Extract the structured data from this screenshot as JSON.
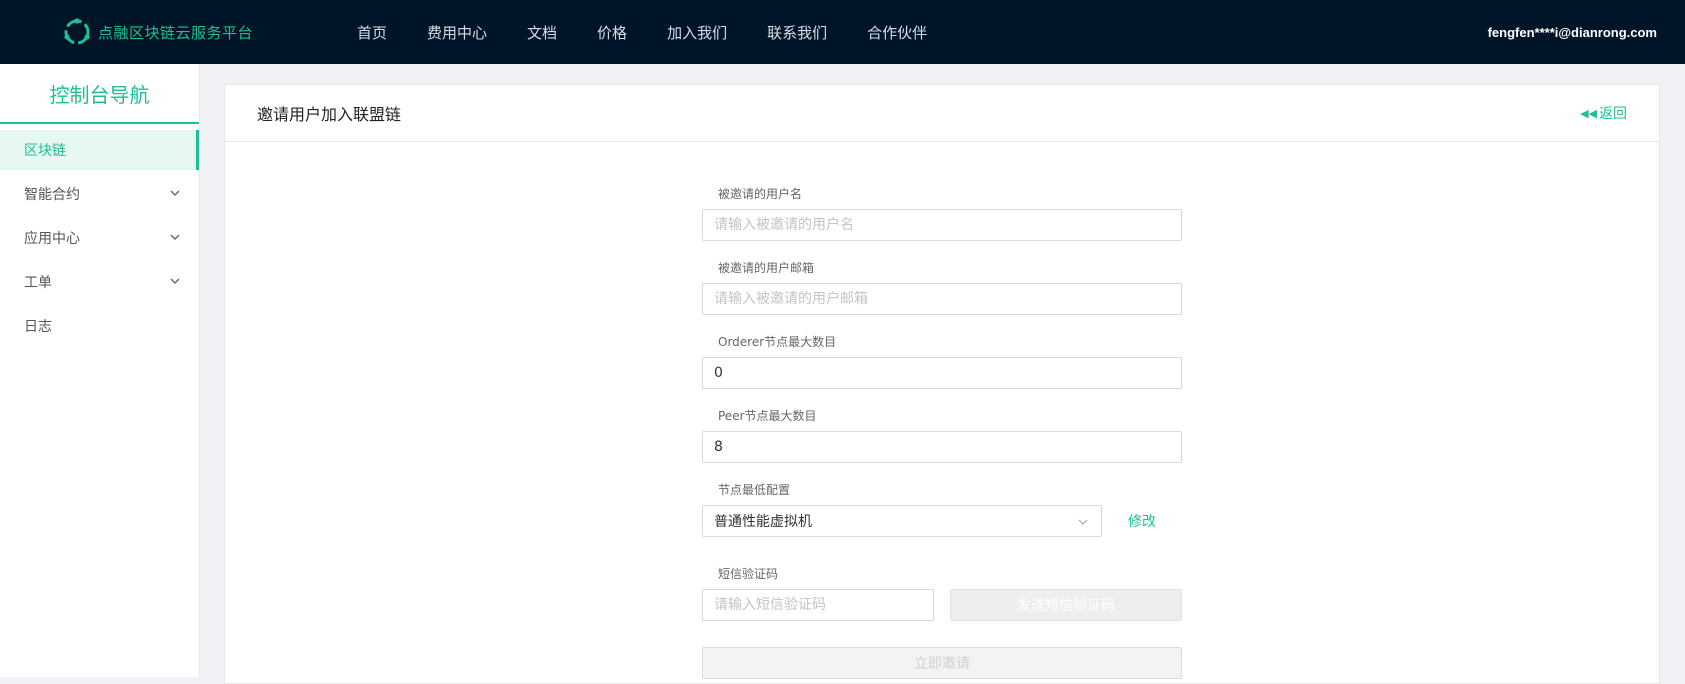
{
  "header": {
    "brand_name": "点融区块链云服务平台",
    "nav": [
      "首页",
      "费用中心",
      "文档",
      "价格",
      "加入我们",
      "联系我们",
      "合作伙伴"
    ],
    "user_email": "fengfen****i@dianrong.com"
  },
  "sidebar": {
    "title": "控制台导航",
    "items": [
      {
        "label": "区块链",
        "active": true,
        "expandable": false
      },
      {
        "label": "智能合约",
        "active": false,
        "expandable": true
      },
      {
        "label": "应用中心",
        "active": false,
        "expandable": true
      },
      {
        "label": "工单",
        "active": false,
        "expandable": true
      },
      {
        "label": "日志",
        "active": false,
        "expandable": false
      }
    ]
  },
  "panel": {
    "title": "邀请用户加入联盟链",
    "back_label": "返回"
  },
  "form": {
    "invitee_username": {
      "label": "被邀请的用户名",
      "placeholder": "请输入被邀请的用户名",
      "value": ""
    },
    "invitee_email": {
      "label": "被邀请的用户邮箱",
      "placeholder": "请输入被邀请的用户邮箱",
      "value": ""
    },
    "orderer_max": {
      "label": "Orderer节点最大数目",
      "value": "0"
    },
    "peer_max": {
      "label": "Peer节点最大数目",
      "value": "8"
    },
    "node_config": {
      "label": "节点最低配置",
      "selected": "普通性能虚拟机",
      "modify_label": "修改"
    },
    "sms_code": {
      "label": "短信验证码",
      "placeholder": "请输入短信验证码",
      "value": "",
      "send_label": "发送短信验证码"
    },
    "submit_label": "立即邀请"
  },
  "colors": {
    "accent": "#1fbf92",
    "topbar_bg": "#011529",
    "active_bg": "#e6f8f1"
  }
}
